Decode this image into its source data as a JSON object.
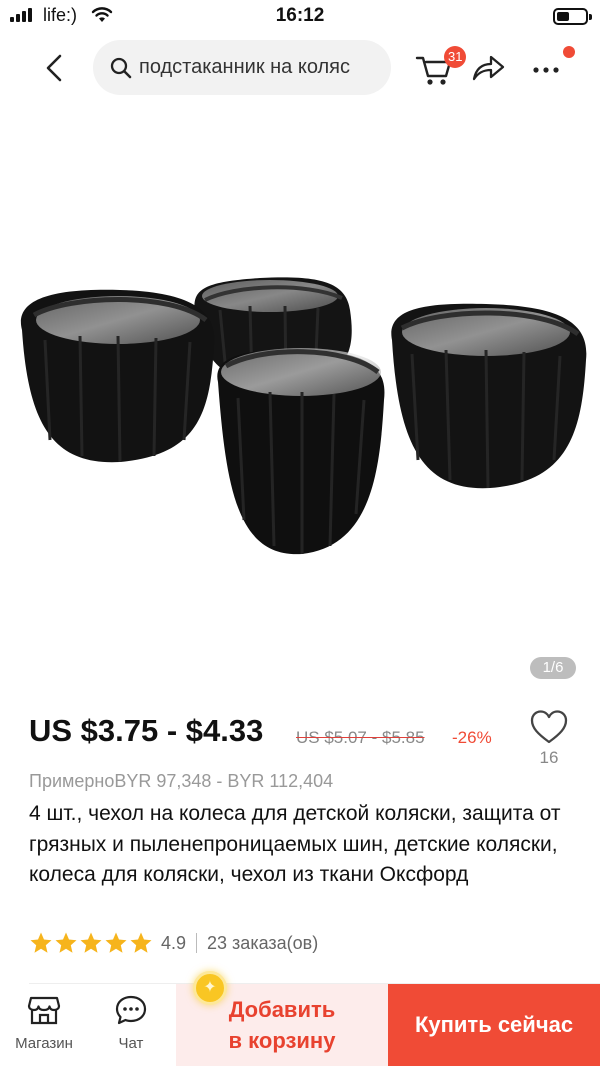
{
  "status_bar": {
    "carrier": "life:)",
    "time": "16:12",
    "icons": [
      "signal-icon",
      "wifi-icon",
      "battery-icon"
    ]
  },
  "nav": {
    "search_query": "подстаканник на коляс",
    "cart_count": "31",
    "icons": [
      "back-icon",
      "search-icon",
      "cart-icon",
      "share-icon",
      "more-icon"
    ],
    "accent_color": "#f04b36"
  },
  "gallery": {
    "counter": "1/6",
    "image_description_icon": "product-photo"
  },
  "product": {
    "price": "US $3.75 - $4.33",
    "old_price": "US $5.07 - $5.85",
    "discount": "-26%",
    "wishlist_count": "16",
    "local_price": "ПримерноBYR 97,348 - BYR 112,404",
    "title": "4 шт., чехол на колеса для детской коляски, защита от грязных и пыленепроницаемых шин, детские коляски, колеса для коляски, чехол из ткани Оксфорд",
    "rating": "4.9",
    "rating_stars": 5,
    "orders": "23 заказа(ов)",
    "star_color": "#f6b41c"
  },
  "bottom_bar": {
    "shop_label": "Магазин",
    "chat_label": "Чат",
    "add_to_cart_line1": "Добавить",
    "add_to_cart_line2": "в корзину",
    "buy_now_label": "Купить сейчас",
    "icons": [
      "store-icon",
      "chat-icon",
      "coin-icon"
    ]
  }
}
